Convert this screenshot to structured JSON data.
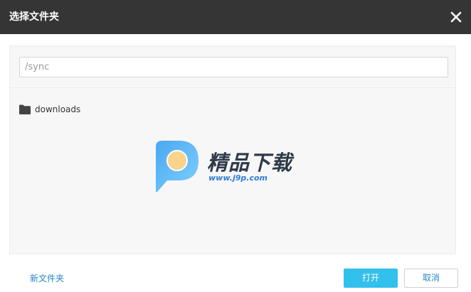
{
  "dialog": {
    "title": "选择文件夹",
    "close_icon": "close-icon"
  },
  "path": {
    "placeholder": "/sync",
    "value": ""
  },
  "folders": [
    {
      "name": "downloads",
      "icon": "folder-icon"
    }
  ],
  "watermark": {
    "brand": "精品下载",
    "site": "www.j9p.com"
  },
  "footer": {
    "new_folder_label": "新文件夹",
    "open_label": "打开",
    "cancel_label": "取消"
  },
  "colors": {
    "titlebar": "#353535",
    "primary_button": "#32c0ec",
    "link": "#2a86c9"
  }
}
